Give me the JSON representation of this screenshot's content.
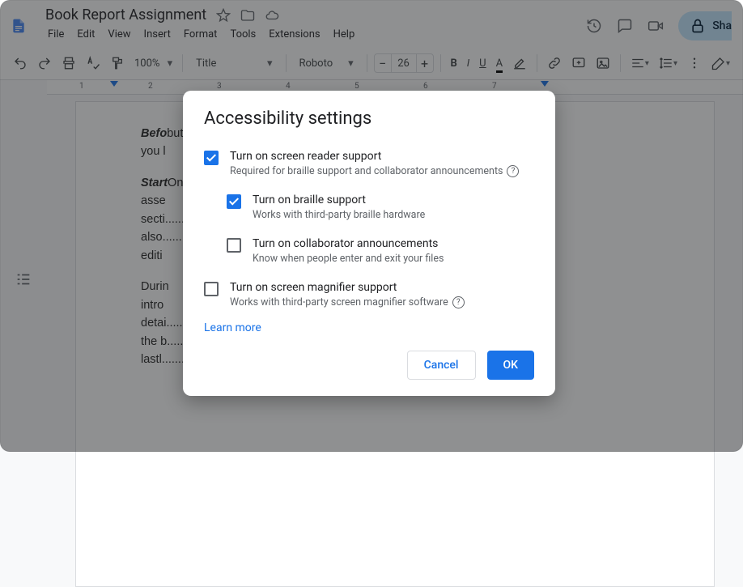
{
  "doc": {
    "title": "Book Report Assignment"
  },
  "menubar": [
    "File",
    "Edit",
    "View",
    "Insert",
    "Format",
    "Tools",
    "Extensions",
    "Help"
  ],
  "header_actions": {
    "share_label": "Sha"
  },
  "toolbar": {
    "zoom": "100%",
    "style": "Title",
    "font": "Roboto",
    "font_size": "26"
  },
  "ruler": {
    "numbers": [
      "1",
      "2",
      "3",
      "4",
      "5",
      "6",
      "7"
    ]
  },
  "page_text": {
    "p1b": "Befo",
    "p1": "but t.......................................................................................k\nyou l",
    "p2b": "Start",
    "p2": "Once..................................................................................y\nasse\nsecti....................................................................................can\nalso.....................................................................................and\nediti",
    "p3": "Durin\nintro\ndetai.........................................................................book\nthe b........................................................................on of\nlastl........................................................................ed"
  },
  "modal": {
    "title": "Accessibility settings",
    "options": [
      {
        "label": "Turn on screen reader support",
        "desc": "Required for braille support and collaborator announcements",
        "checked": true,
        "help": true,
        "indent": false
      },
      {
        "label": "Turn on braille support",
        "desc": "Works with third-party braille hardware",
        "checked": true,
        "help": false,
        "indent": true
      },
      {
        "label": "Turn on collaborator announcements",
        "desc": "Know when people enter and exit your files",
        "checked": false,
        "help": false,
        "indent": true
      },
      {
        "label": "Turn on screen magnifier support",
        "desc": "Works with third-party screen magnifier software",
        "checked": false,
        "help": true,
        "indent": false
      }
    ],
    "learn_more": "Learn more",
    "cancel": "Cancel",
    "ok": "OK"
  }
}
